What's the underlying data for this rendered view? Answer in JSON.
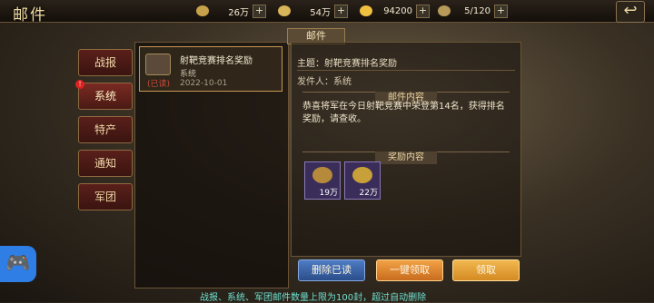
{
  "header": {
    "title": "邮件"
  },
  "resources": [
    {
      "icon": "wheat-icon",
      "value": "26万"
    },
    {
      "icon": "coin-icon",
      "value": "54万"
    },
    {
      "icon": "gold-icon",
      "value": "94200"
    },
    {
      "icon": "capacity-icon",
      "value": "5/120"
    }
  ],
  "sidebar": {
    "items": [
      {
        "label": "战报"
      },
      {
        "label": "系统",
        "badge": "!"
      },
      {
        "label": "特产"
      },
      {
        "label": "通知"
      },
      {
        "label": "军团"
      }
    ]
  },
  "list": {
    "items": [
      {
        "title": "射靶竞赛排名奖励",
        "sender": "系统",
        "status": "(已读)",
        "date": "2022-10-01"
      }
    ]
  },
  "detail": {
    "panel_header": "邮件",
    "subject": "主题：射靶竞赛排名奖励",
    "sender": "发件人：系统",
    "content_header": "邮件内容",
    "content": "恭喜将军在今日射靶竞赛中荣登第14名，获得排名奖励，请查收。",
    "reward_header": "奖励内容",
    "rewards": [
      {
        "icon": "coin-bag-icon",
        "amount": "19万"
      },
      {
        "icon": "gold-coin-icon",
        "amount": "22万"
      }
    ]
  },
  "buttons": {
    "delete_read": "删除已读",
    "claim_all": "一键领取",
    "claim": "领取"
  },
  "footer": {
    "note": "战报、系统、军团邮件数量上限为100封，超过自动删除"
  }
}
